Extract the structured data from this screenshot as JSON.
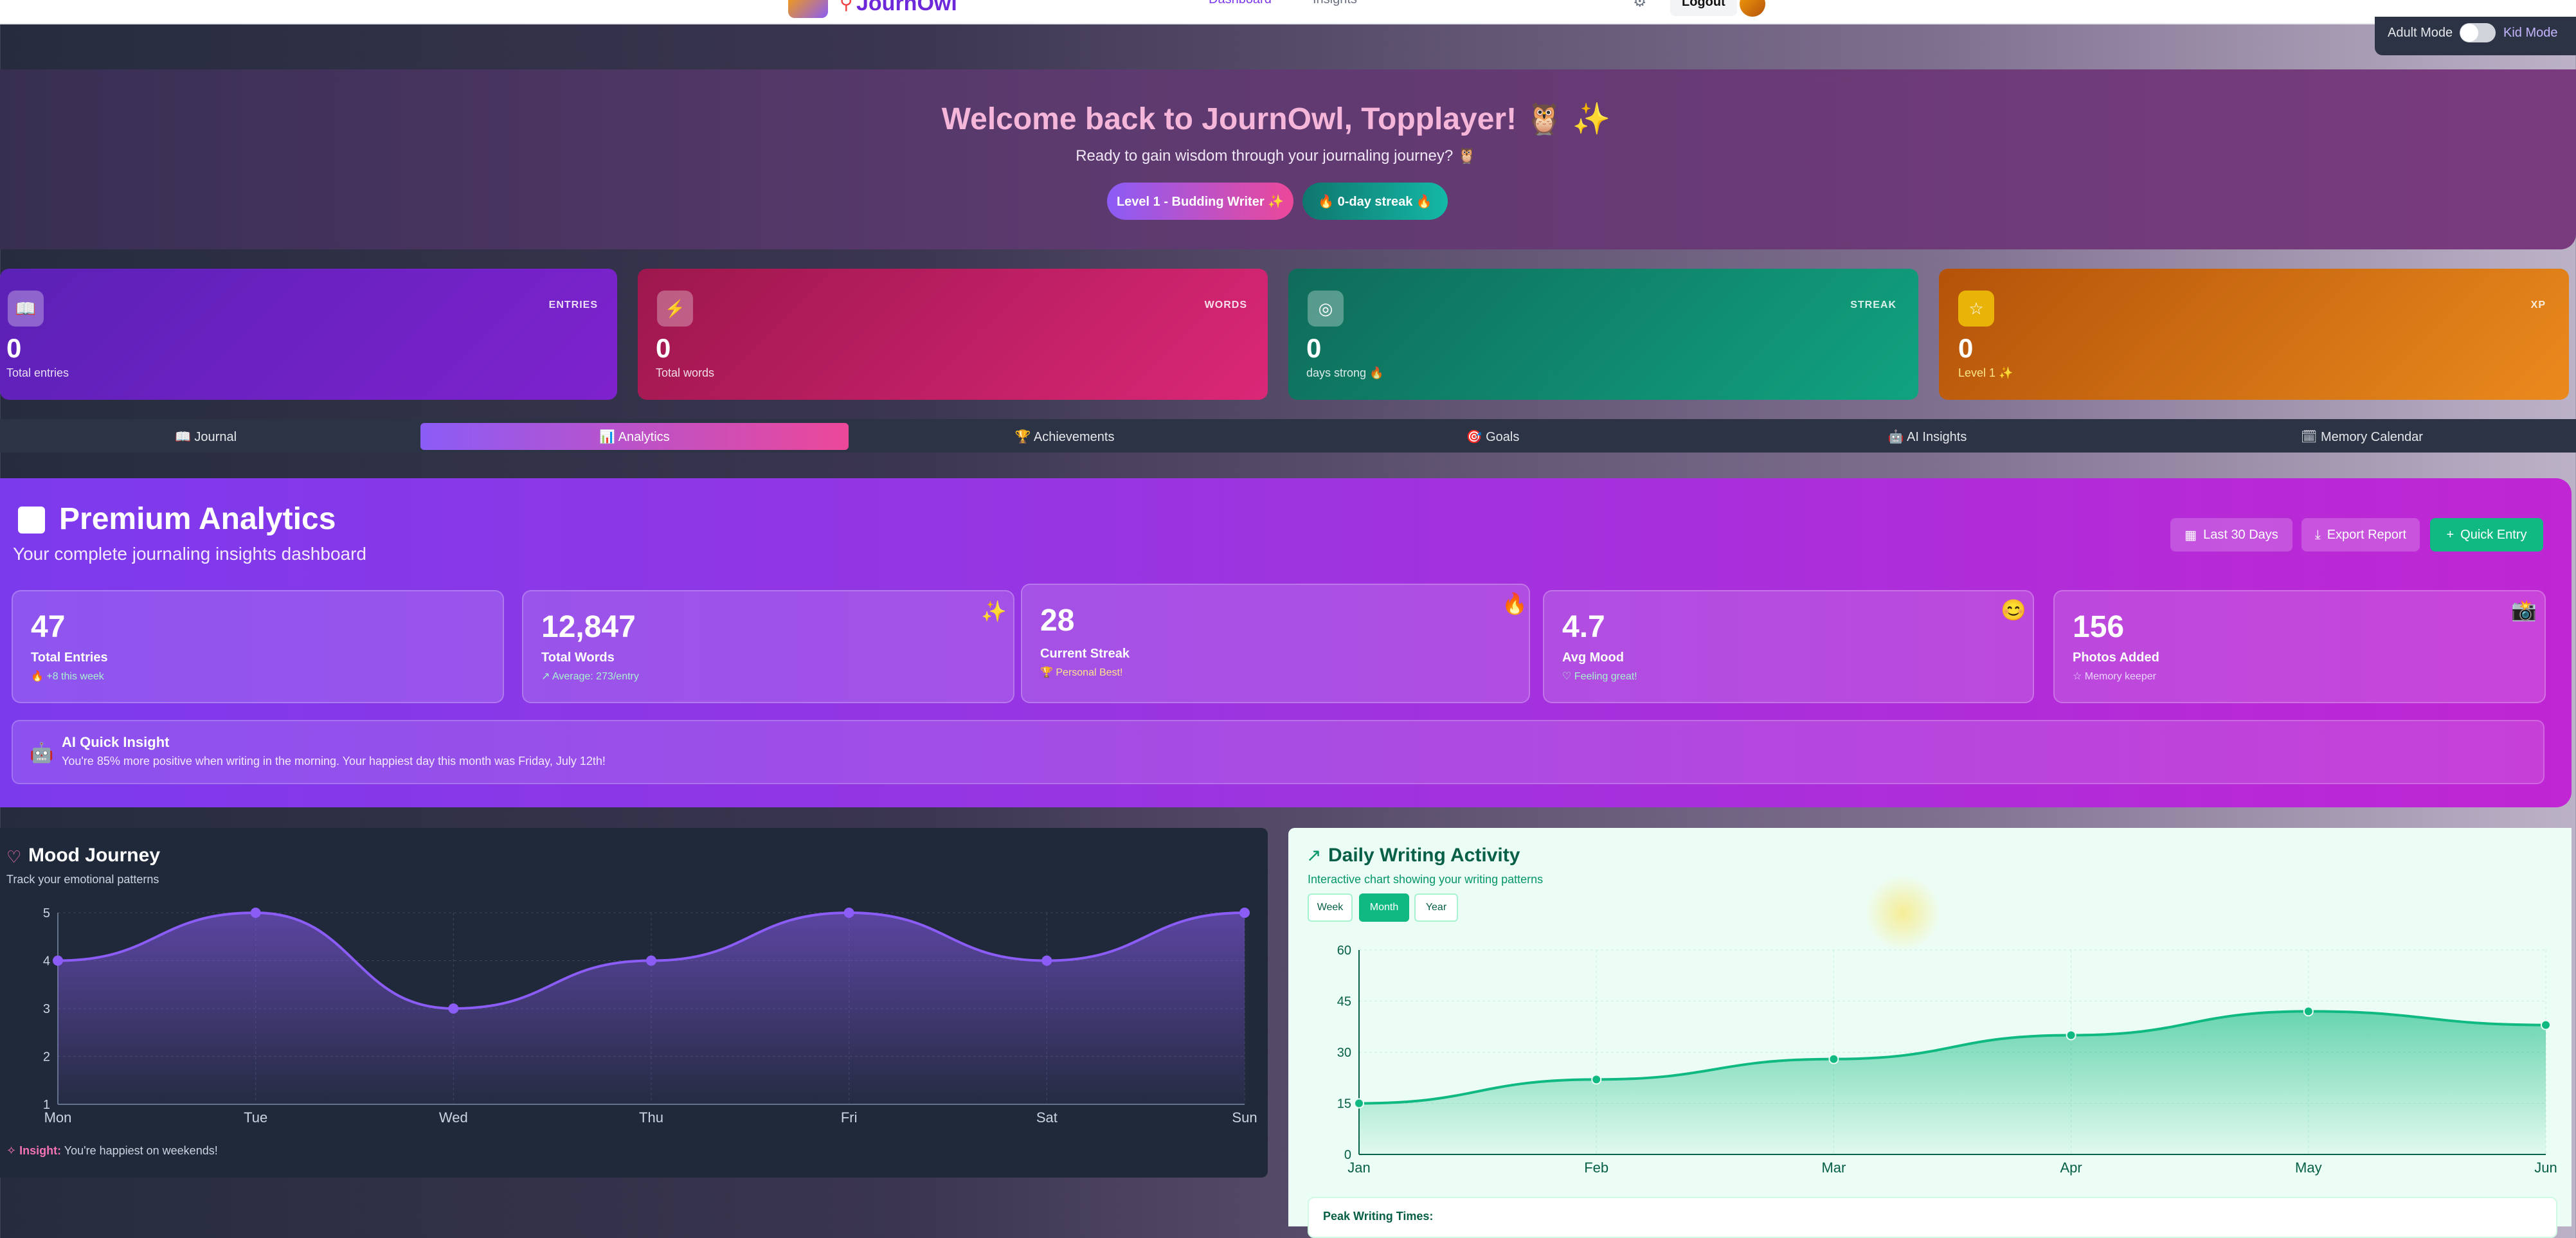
{
  "topnav": {
    "brand": "JournOwl",
    "links": [
      "Dashboard",
      "Insights"
    ],
    "logout": "Logout"
  },
  "mode": {
    "adult": "Adult Mode",
    "kid": "Kid Mode"
  },
  "welcome": {
    "title": "Welcome back to JournOwl, Topplayer! 🦉 ✨",
    "subtitle": "Ready to gain wisdom through your journaling journey? 🦉",
    "level_pill": "Level 1 - Budding Writer ✨",
    "streak_pill": "🔥 0-day streak 🔥"
  },
  "stats": [
    {
      "label": "ENTRIES",
      "value": "0",
      "caption": "Total entries",
      "icon": "book-icon"
    },
    {
      "label": "WORDS",
      "value": "0",
      "caption": "Total words",
      "icon": "lightning-icon"
    },
    {
      "label": "STREAK",
      "value": "0",
      "caption": "days strong 🔥",
      "icon": "target-icon"
    },
    {
      "label": "XP",
      "value": "0",
      "caption": "Level 1 ✨",
      "icon": "star-icon"
    }
  ],
  "tabs": [
    {
      "label": "📖 Journal"
    },
    {
      "label": "📊 Analytics",
      "active": true
    },
    {
      "label": "🏆 Achievements"
    },
    {
      "label": "🎯 Goals"
    },
    {
      "label": "🤖 AI Insights"
    },
    {
      "label": "🗓 Memory Calendar"
    }
  ],
  "premium": {
    "title": "Premium Analytics",
    "subtitle": "Your complete journaling insights dashboard",
    "range_button": "Last 30 Days",
    "export_button": "Export Report",
    "quick_button": "Quick Entry",
    "metrics": [
      {
        "value": "47",
        "label": "Total Entries",
        "trend": "🔥 +8 this week",
        "emoji": ""
      },
      {
        "value": "12,847",
        "label": "Total Words",
        "trend": "↗ Average: 273/entry",
        "emoji": "✨"
      },
      {
        "value": "28",
        "label": "Current Streak",
        "trend": "🏆 Personal Best!",
        "emoji": "🔥"
      },
      {
        "value": "4.7",
        "label": "Avg Mood",
        "trend": "♡ Feeling great!",
        "emoji": "😊"
      },
      {
        "value": "156",
        "label": "Photos Added",
        "trend": "☆ Memory keeper",
        "emoji": "📸"
      }
    ],
    "ai_insight": {
      "title": "AI Quick Insight",
      "text": "You're 85% more positive when writing in the morning. Your happiest day this month was Friday, July 12th!"
    }
  },
  "mood": {
    "title": "Mood Journey",
    "subtitle": "Track your emotional patterns",
    "insight_label": "Insight:",
    "insight_text": " You're happiest on weekends!"
  },
  "writing": {
    "title": "Daily Writing Activity",
    "subtitle": "Interactive chart showing your writing patterns",
    "buttons": [
      "Week",
      "Month",
      "Year"
    ],
    "active_button": "Month",
    "peak_label": "Peak Writing Times:"
  },
  "chart_data": [
    {
      "type": "area",
      "categories": [
        "Mon",
        "Tue",
        "Wed",
        "Thu",
        "Fri",
        "Sat",
        "Sun"
      ],
      "values": [
        4,
        5,
        3,
        4,
        5,
        4,
        5
      ],
      "ylim": [
        1,
        5
      ],
      "yticks": [
        1,
        2,
        3,
        4,
        5
      ],
      "color": "#8b5cf6",
      "grid": true
    },
    {
      "type": "area",
      "categories": [
        "Jan",
        "Feb",
        "Mar",
        "Apr",
        "May",
        "Jun"
      ],
      "values": [
        15,
        22,
        28,
        35,
        42,
        38
      ],
      "ylim": [
        0,
        60
      ],
      "yticks": [
        0,
        15,
        30,
        45,
        60
      ],
      "color": "#10b981",
      "grid": true
    }
  ]
}
